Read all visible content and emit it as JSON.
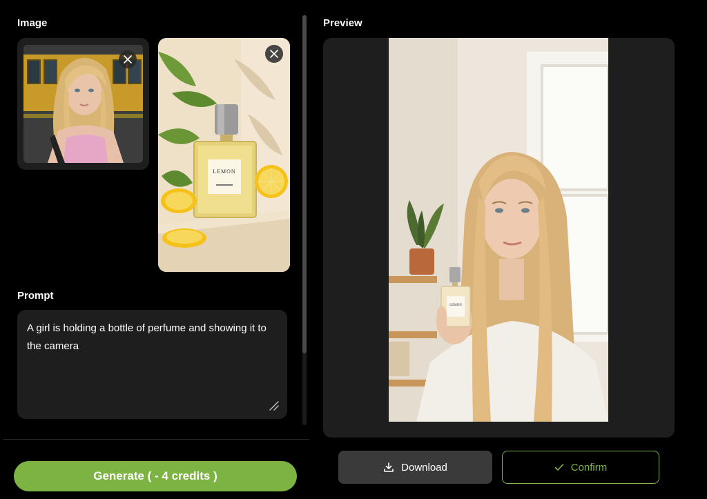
{
  "sections": {
    "image_label": "Image",
    "prompt_label": "Prompt",
    "preview_label": "Preview"
  },
  "uploads": [
    {
      "id": "upload-1",
      "subject": "selfie of a blonde girl in a subway station",
      "remove_icon": "close-icon"
    },
    {
      "id": "upload-2",
      "subject": "perfume bottle labeled LEMON with lemon slices",
      "label_text": "LEMON",
      "remove_icon": "close-icon"
    }
  ],
  "prompt": {
    "value": "A girl is holding a bottle of perfume and showing it to the camera"
  },
  "actions": {
    "generate_label": "Generate ( - 4 credits )",
    "download_label": "Download",
    "download_icon": "download-icon",
    "confirm_label": "Confirm",
    "confirm_icon": "check-icon"
  },
  "preview": {
    "subject": "girl holding a LEMON perfume bottle in a bright room",
    "bottle_label": "LEMON"
  },
  "colors": {
    "background": "#000000",
    "panel": "#1e1e1e",
    "accent": "#7cb342",
    "button_secondary": "#3a3a3a"
  }
}
